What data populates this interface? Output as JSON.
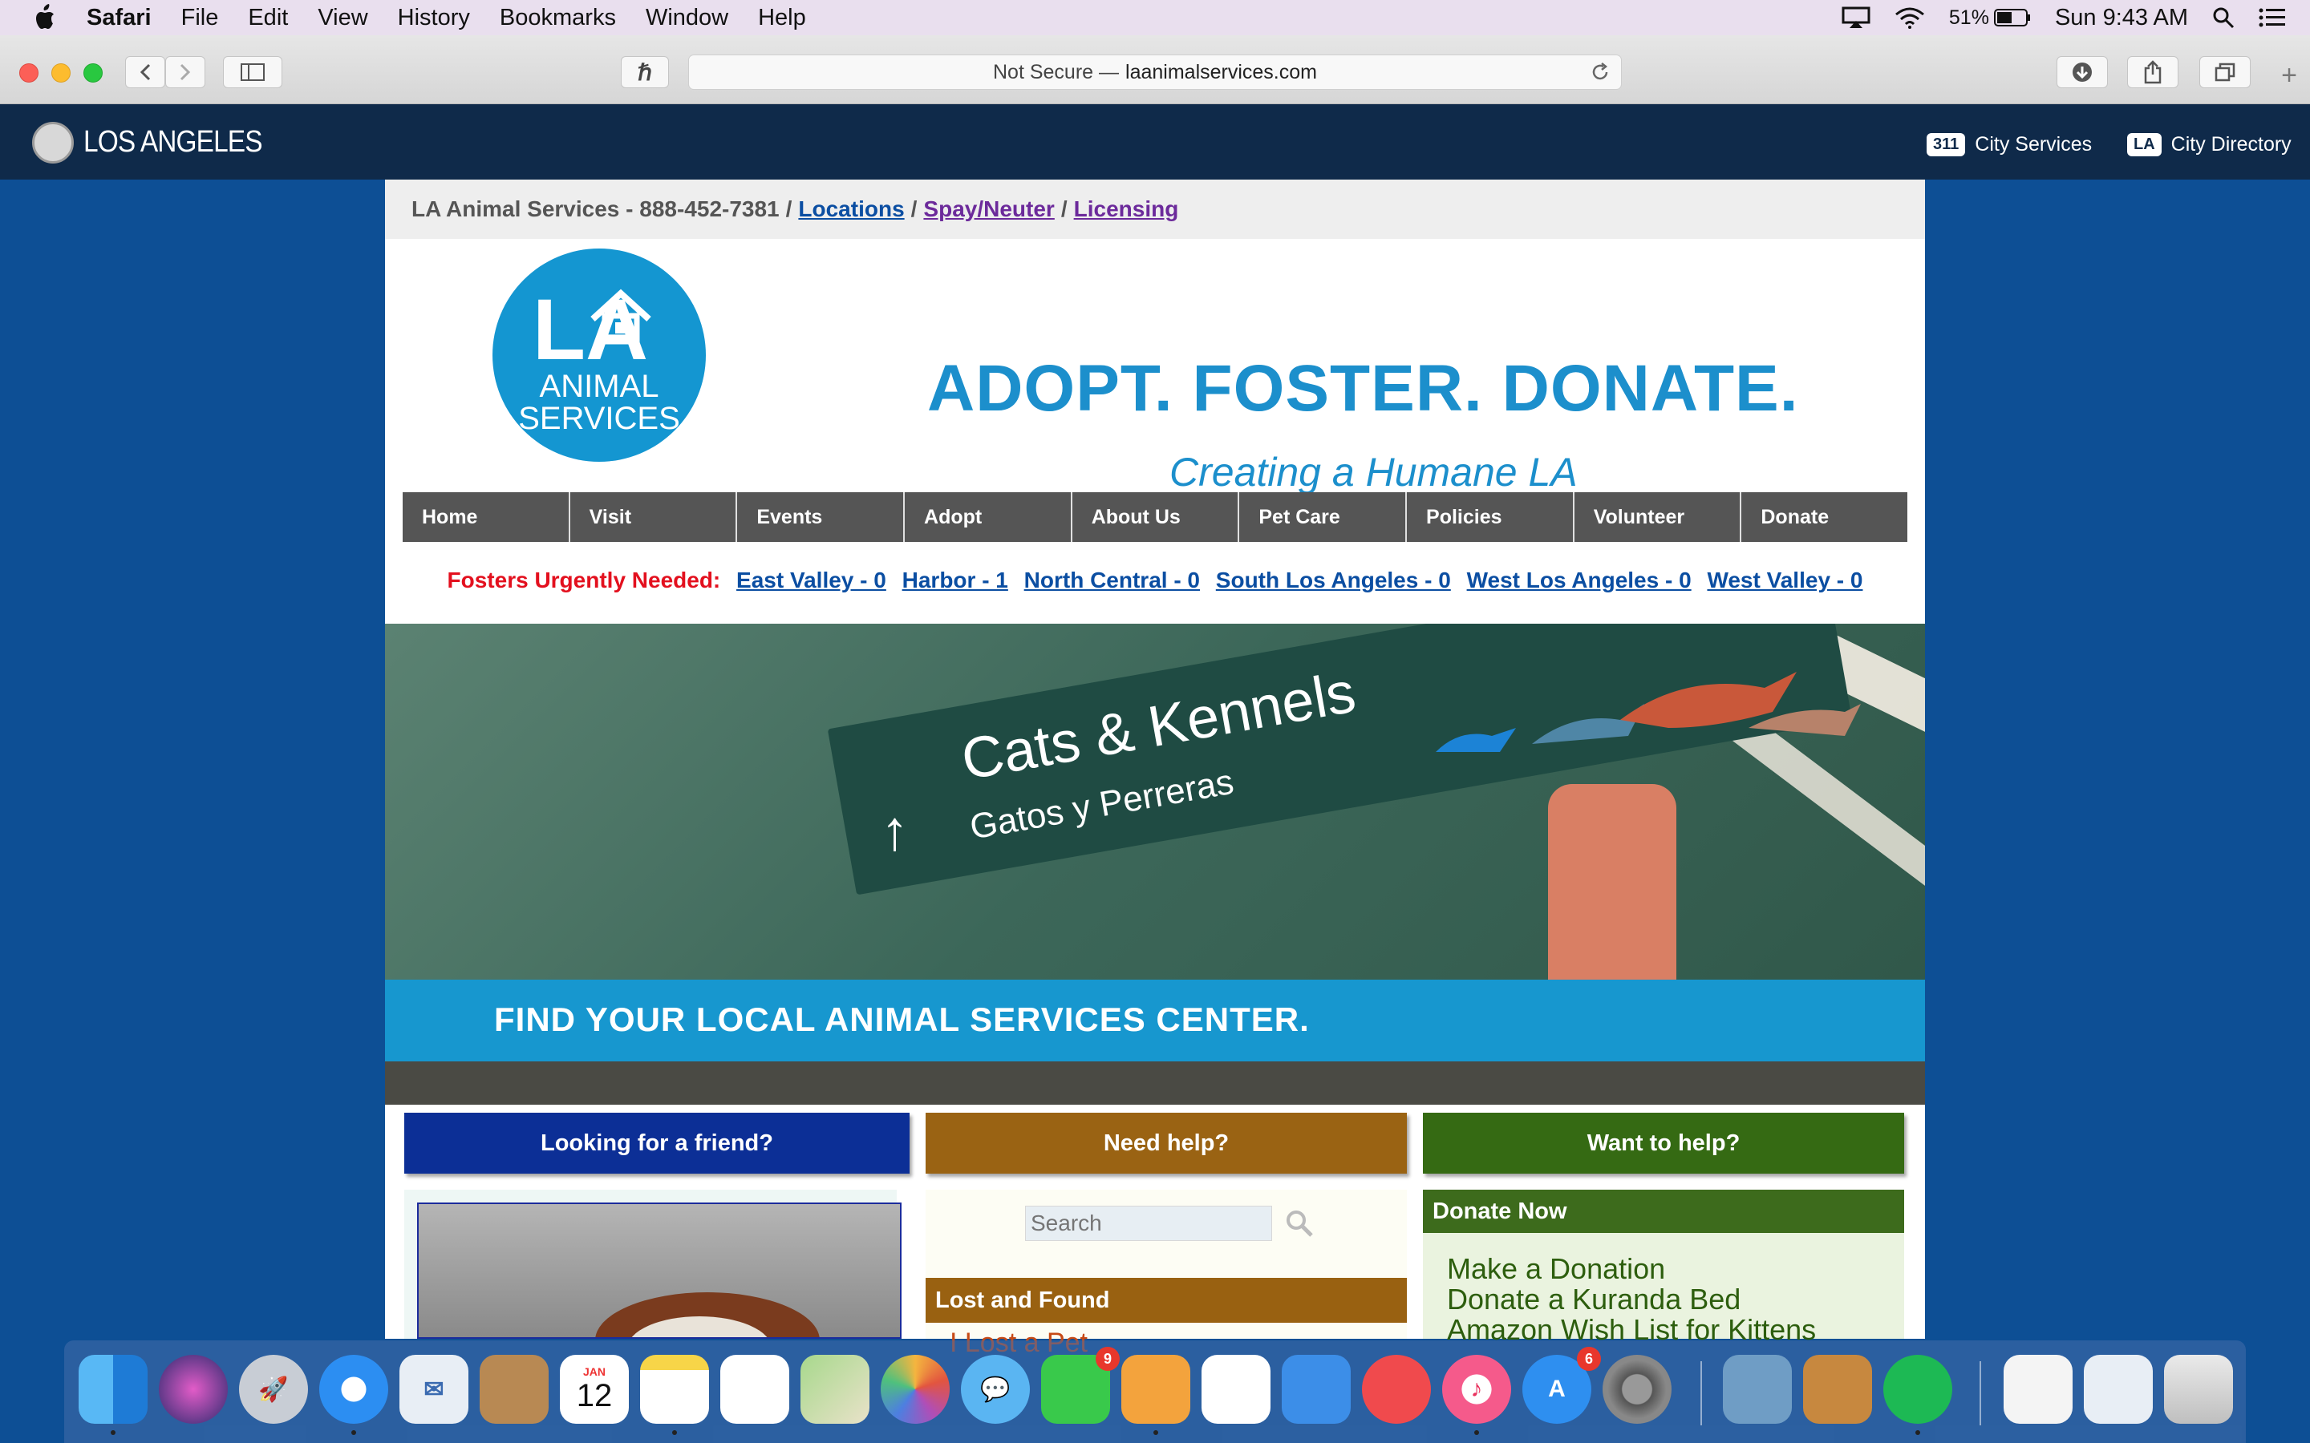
{
  "menubar": {
    "app_name": "Safari",
    "items": [
      "File",
      "Edit",
      "View",
      "History",
      "Bookmarks",
      "Window",
      "Help"
    ],
    "battery": "51%",
    "clock": "Sun 9:43 AM"
  },
  "browser": {
    "address_prefix": "Not Secure —",
    "address_host": "laanimalservices.com"
  },
  "city_header": {
    "name": "LOS ANGELES",
    "links": [
      {
        "badge": "311",
        "label": "City Services"
      },
      {
        "badge": "LA",
        "label": "City Directory"
      }
    ]
  },
  "topline": {
    "org": "LA Animal Services - 888-452-7381",
    "sep": "/",
    "locations": "Locations",
    "spay": "Spay/Neuter",
    "licensing": "Licensing"
  },
  "banner": {
    "logo_la": "LA",
    "logo_line1": "ANIMAL",
    "logo_line2": "SERVICES",
    "slogan": "ADOPT. FOSTER. DONATE.",
    "tagline": "Creating a Humane LA"
  },
  "nav": [
    "Home",
    "Visit",
    "Events",
    "Adopt",
    "About Us",
    "Pet Care",
    "Policies",
    "Volunteer",
    "Donate"
  ],
  "fosters": {
    "label": "Fosters Urgently Needed:",
    "links": [
      "East Valley - 0",
      "Harbor - 1",
      "North Central - 0",
      "South Los Angeles - 0",
      "West Los Angeles - 0",
      "West Valley - 0"
    ]
  },
  "hero": {
    "sign_line1": "Cats & Kennels",
    "sign_line2": "Gatos y Perreras",
    "caption": "FIND YOUR LOCAL ANIMAL SERVICES CENTER."
  },
  "cta": {
    "friend": "Looking for a friend?",
    "help": "Need help?",
    "want": "Want to help?",
    "colors": {
      "friend": "#0c2f96",
      "help": "#9a6313",
      "want": "#356a13"
    }
  },
  "search": {
    "placeholder": "Search"
  },
  "lost_found": {
    "heading": "Lost and Found",
    "link": "I Lost a Pet"
  },
  "donate": {
    "heading": "Donate Now",
    "links": [
      "Make a Donation",
      "Donate a Kuranda Bed",
      "Amazon Wish List for Kittens"
    ]
  },
  "dock": {
    "calendar_month": "JAN",
    "calendar_day": "12",
    "facetime_badge": "9",
    "appstore_badge": "6"
  }
}
